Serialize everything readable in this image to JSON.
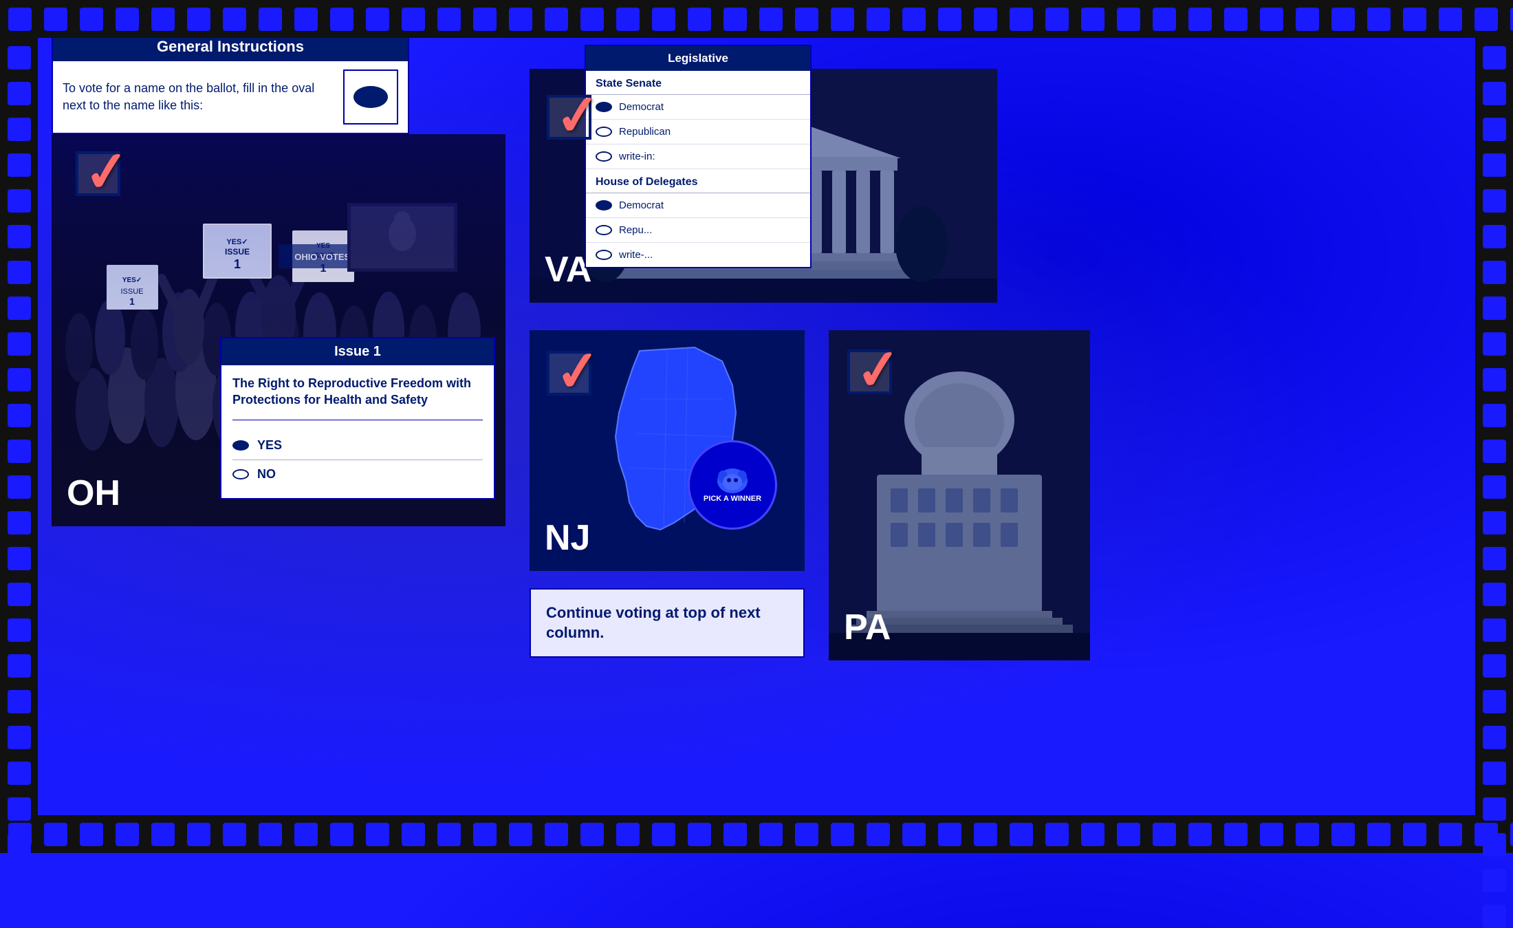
{
  "filmStrip": {
    "holeCount": 55
  },
  "generalInstructions": {
    "header": "General Instructions",
    "body": "To vote for a name on the ballot, fill in the oval next to the name like this:"
  },
  "ohCard": {
    "label": "OH"
  },
  "issue1Card": {
    "header": "Issue 1",
    "title": "The Right to Reproductive Freedom with Protections for Health and Safety",
    "options": [
      {
        "label": "YES",
        "filled": true
      },
      {
        "label": "NO",
        "filled": false
      }
    ]
  },
  "vaCard": {
    "label": "VA"
  },
  "legislativeCard": {
    "header": "Legislative",
    "stateSenate": "State Senate",
    "stateSenateOptions": [
      {
        "label": "Democrat",
        "filled": true
      },
      {
        "label": "Republican",
        "filled": false
      },
      {
        "label": "write-in:",
        "filled": false
      }
    ],
    "houseDelegates": "House of Delegates",
    "houseDelegatesOptions": [
      {
        "label": "Democrat",
        "filled": true
      },
      {
        "label": "Repu...",
        "filled": false
      },
      {
        "label": "write-...",
        "filled": false
      }
    ]
  },
  "njCard": {
    "label": "NJ",
    "badgeText": "PICK A WINNER"
  },
  "continueVoting": {
    "text": "Continue voting at top of next column."
  },
  "paCard": {
    "label": "PA"
  }
}
